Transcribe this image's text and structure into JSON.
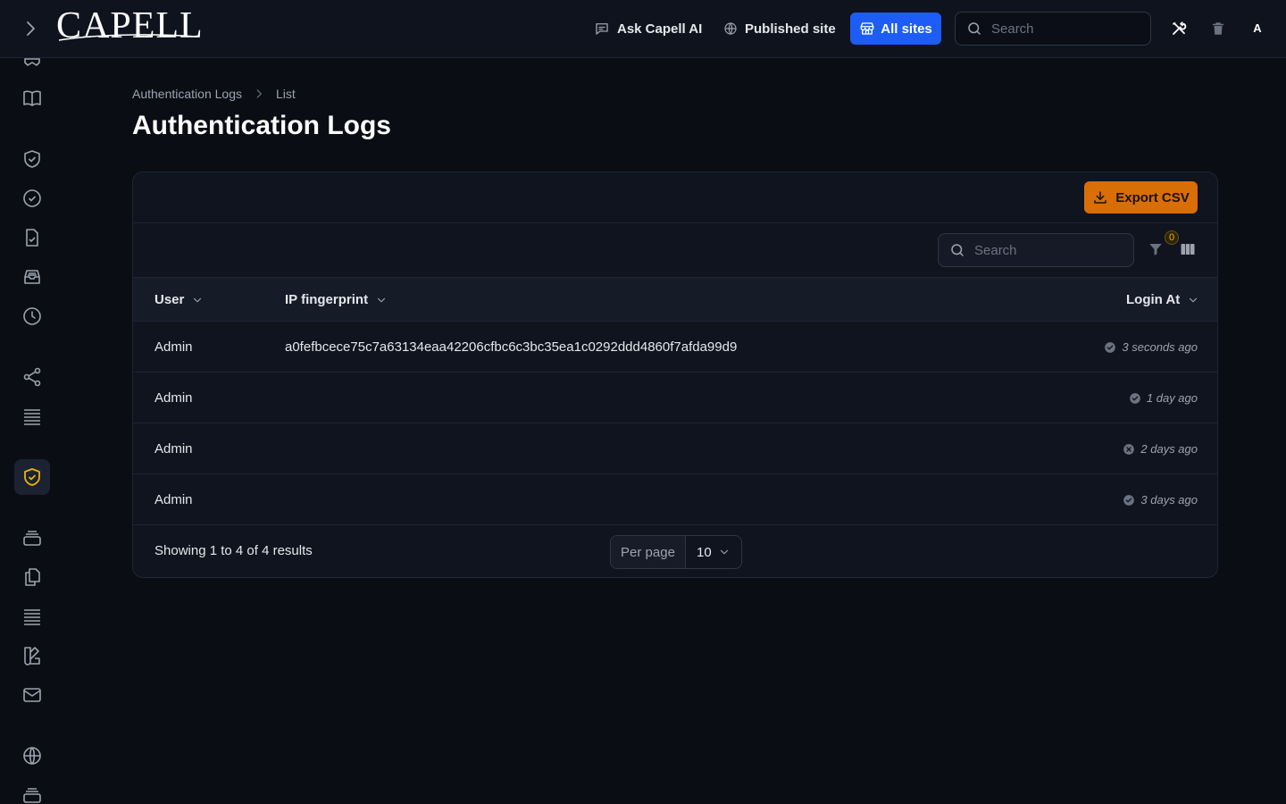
{
  "app": {
    "logo_text": "CAPELL"
  },
  "topbar": {
    "ask_ai_label": "Ask Capell AI",
    "published_label": "Published site",
    "all_sites_label": "All sites",
    "search_placeholder": "Search",
    "avatar_initial": "A",
    "accent_color": "#1d5cf5"
  },
  "sidebar": {
    "icons": [
      "bookmark-icon",
      "book-icon",
      "shield-check-icon",
      "check-circle-icon",
      "document-check-icon",
      "inbox-icon",
      "clock-icon",
      "share-icon",
      "list-icon",
      "shield-check-active-icon",
      "stack-icon",
      "copy-icon",
      "list-icon",
      "swatch-icon",
      "mail-icon",
      "globe-icon",
      "stack-icon"
    ],
    "active_item": "shield-check-active-icon"
  },
  "breadcrumb": {
    "parent": "Authentication Logs",
    "current": "List"
  },
  "page": {
    "title": "Authentication Logs"
  },
  "card": {
    "export_label": "Export CSV",
    "export_color": "#d96d06",
    "search_placeholder": "Search",
    "filter_count": "0"
  },
  "table": {
    "columns": {
      "user": "User",
      "ip": "IP fingerprint",
      "login_at": "Login At"
    },
    "rows": [
      {
        "user": "Admin",
        "ip": "a0fefbcece75c7a63134eaa42206cfbc6c3bc35ea1c0292ddd4860f7afda99d9",
        "login_at": "3 seconds ago",
        "status": "success"
      },
      {
        "user": "Admin",
        "ip": "",
        "login_at": "1 day ago",
        "status": "success"
      },
      {
        "user": "Admin",
        "ip": "",
        "login_at": "2 days ago",
        "status": "failed"
      },
      {
        "user": "Admin",
        "ip": "",
        "login_at": "3 days ago",
        "status": "success"
      }
    ]
  },
  "pagination": {
    "results_text": "Showing 1 to 4 of 4 results",
    "per_page_label": "Per page",
    "per_page_value": "10"
  }
}
